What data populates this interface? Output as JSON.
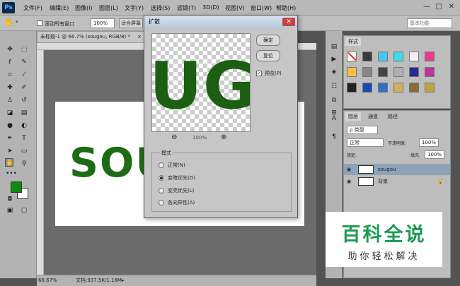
{
  "menubar": {
    "logo": "Ps",
    "items": [
      "文件(F)",
      "编辑(E)",
      "图像(I)",
      "图层(L)",
      "文字(Y)",
      "选择(S)",
      "滤镜(T)",
      "3D(D)",
      "视图(V)",
      "窗口(W)",
      "帮助(H)"
    ],
    "window_controls": [
      "—",
      "□",
      "✕"
    ]
  },
  "options_bar": {
    "scroll_all_label": "滚动所有窗口",
    "zoom_value": "100%",
    "fit_screen_label": "适合屏幕",
    "workspace_value": "基本功能"
  },
  "document": {
    "tab_title": "未标题-1 @ 66.7% (sougou, RGB/8) *",
    "tab_close": "×",
    "canvas_text": "SOUG",
    "zoom_status": "66.67%",
    "doc_status": "文档:937.5K/1.16M"
  },
  "toolbar": {
    "tools": [
      "move-tool",
      "marquee-tool",
      "lasso-tool",
      "quick-select-tool",
      "crop-tool",
      "eyedropper-tool",
      "healing-tool",
      "brush-tool",
      "stamp-tool",
      "history-brush-tool",
      "eraser-tool",
      "gradient-tool",
      "blur-tool",
      "dodge-tool",
      "pen-tool",
      "type-tool",
      "path-select-tool",
      "shape-tool",
      "hand-tool",
      "zoom-tool"
    ],
    "foreground_color": "#0f8a0f",
    "background_color": "#ffffff"
  },
  "dialog": {
    "title": "扩散",
    "close": "✕",
    "preview_text": "UG",
    "zoom_value": "100%",
    "ok_label": "确定",
    "reset_label": "复位",
    "preview_label": "预览(P)",
    "preview_checked": true,
    "mode_group_label": "模式",
    "modes": [
      {
        "label": "正常(N)",
        "selected": false
      },
      {
        "label": "变暗优先(D)",
        "selected": true
      },
      {
        "label": "变亮优先(L)",
        "selected": false
      },
      {
        "label": "各向异性(A)",
        "selected": false
      }
    ]
  },
  "swatches_panel": {
    "tab": "样式",
    "colors": [
      "#d12a2a",
      "#3a3a3a",
      "#48c8e8",
      "#3fd8e8",
      "#f0f0f0",
      "#e83a8a",
      "#f0c040",
      "#888888",
      "#444444",
      "#b0b0b0",
      "#2a2a8a",
      "#c030a0",
      "#222222",
      "#1a4ab0",
      "#3070c0",
      "#ccb060",
      "#8a6a3a",
      "#c0a040"
    ]
  },
  "layers_panel": {
    "tabs": [
      "图层",
      "通道",
      "路径"
    ],
    "kind_filter": "ρ 类型",
    "blend_mode": "正常",
    "opacity_label": "不透明度:",
    "opacity_value": "100%",
    "lock_label": "锁定:",
    "fill_label": "填充:",
    "fill_value": "100%",
    "layers": [
      {
        "name": "sougou",
        "selected": true
      },
      {
        "name": "背景",
        "selected": false
      }
    ]
  },
  "watermark": {
    "title": "百科全说",
    "subtitle": "助你轻松解决"
  }
}
